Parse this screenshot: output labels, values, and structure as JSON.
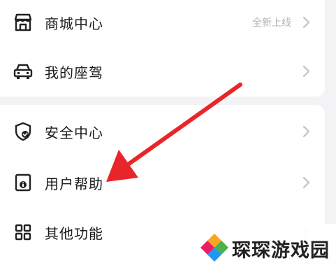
{
  "menu_group_1": [
    {
      "label": "商城中心",
      "sub": "全新上线",
      "icon": "store-icon"
    },
    {
      "label": "我的座驾",
      "sub": "",
      "icon": "car-icon"
    }
  ],
  "menu_group_2": [
    {
      "label": "安全中心",
      "icon": "shield-check-icon"
    },
    {
      "label": "用户帮助",
      "icon": "help-doc-icon"
    },
    {
      "label": "其他功能",
      "icon": "grid-icon"
    }
  ],
  "watermark": {
    "text": "琛琛游戏园"
  },
  "colors": {
    "background": "#f3f3f5",
    "card": "#ffffff",
    "text": "#1a1a1a",
    "muted": "#b3b3b3",
    "chevron": "#c8c8c8",
    "arrow": "#e8262a"
  }
}
